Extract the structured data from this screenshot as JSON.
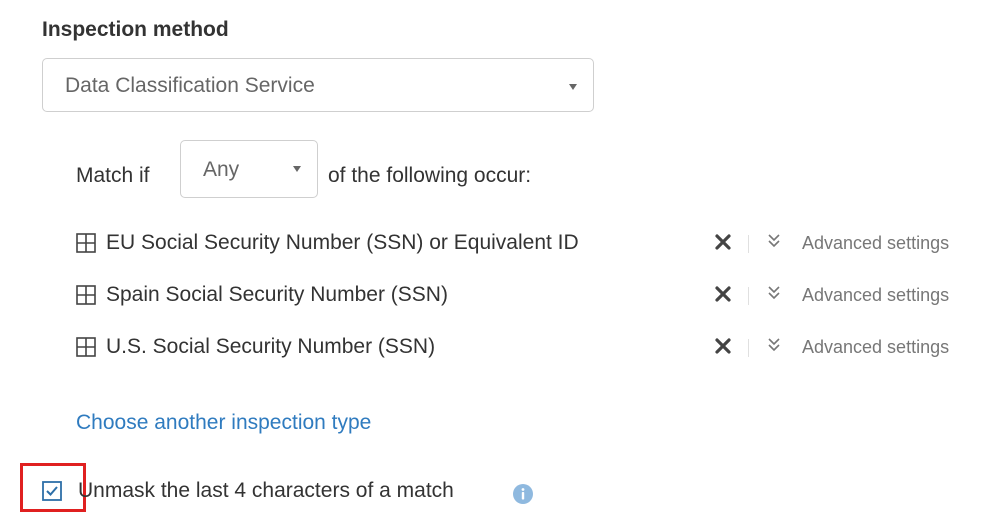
{
  "inspection": {
    "label": "Inspection method",
    "selected": "Data Classification Service"
  },
  "match": {
    "prefix": "Match if",
    "selected": "Any",
    "suffix": "of the following occur:"
  },
  "items": [
    {
      "name": "EU Social Security Number (SSN) or Equivalent ID",
      "advanced": "Advanced settings"
    },
    {
      "name": "Spain Social Security Number (SSN)",
      "advanced": "Advanced settings"
    },
    {
      "name": "U.S. Social Security Number (SSN)",
      "advanced": "Advanced settings"
    }
  ],
  "choose_link": "Choose another inspection type",
  "unmask": {
    "label": "Unmask the last 4 characters of a match",
    "checked": true
  },
  "icons": {
    "item": "grid-icon",
    "remove": "close-icon",
    "advanced": "double-chevron-down-icon",
    "info": "info-icon"
  },
  "colors": {
    "link": "#2f7bbf",
    "highlight": "#e02020",
    "info": "#8fb9df",
    "checkbox": "#2d6fa8"
  }
}
